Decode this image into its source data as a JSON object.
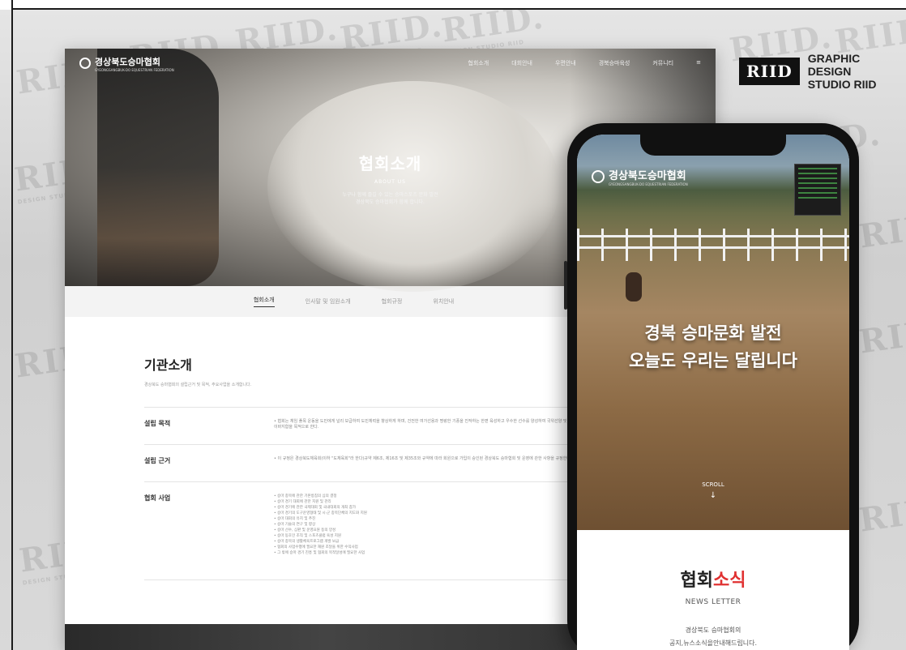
{
  "brand": {
    "logo": "RIID",
    "line1": "GRAPHIC DESIGN",
    "line2": "STUDIO RIID"
  },
  "watermark": {
    "text": "RIID.",
    "sub": "DESIGN STUDIO RIID"
  },
  "desktop": {
    "logo": "경상북도승마협회",
    "logo_sub": "GYEONGSANGBUK-DO EQUESTRIAN FEDERATION",
    "menu": [
      "협회소개",
      "대회안내",
      "우편안내",
      "경북승마육성",
      "커뮤니티",
      "≡"
    ],
    "hero_title": "협회소개",
    "hero_sub": "ABOUT US",
    "hero_desc": "누구나 함께 즐길 수 있는 승마스포츠 문화 발전\n경상북도 승마협회가 함께 합니다.",
    "tabs": [
      "협회소개",
      "인사말 및 임원소개",
      "협회규정",
      "위치안내"
    ],
    "section_title": "기관소개",
    "section_lead": "경상북도 승마협회의 설립근거 및 목적, 주요사업을 소개합니다.",
    "rows": [
      {
        "label": "설립 목적",
        "text": "• 협회는 체임 풀목 운동을 도민에게 널리 보급하여 도민체력을 향상하게 하며, 건전한 여가선용과 명랑한 기풍을 진작하는 한편 육성하고 우수한 선수를 양성하여 국위선양 및 지역체육 발전에 이바지함을 목적으로 한다."
      },
      {
        "label": "설립 근거",
        "text": "• 이 규정은 경상북도체육회(이하 \"도체육회\"라 한다)규약 제6조, 제16조 및 제35조와 규약에 따라 회원으로 가입이 승인된 경상북도 승마협회 및 운영에 관한 사항을 규정한다."
      },
      {
        "label": "협회 사업",
        "list": [
          "• 승마 종목에 관한 기본방침의 심의 결정",
          "• 승마 경기 대회에 관한 지원 및 관리",
          "• 승마 경기에 관한 국제대회 및 국내대회의 개최 참가",
          "• 승마 경기의 도구운영형태 및 시·군 종목단체의 지도와 지원",
          "• 승마 대회의 유치 및 추진",
          "• 승마 기술의 연구 및 향상",
          "• 승마 선수, 심판 및 운영요원 등의 양성",
          "• 승마 동호인 조직 및 스포츠클럽 육성 지원",
          "• 승마 종목의 생활체육프로그램 개발 보급",
          "• 협회의 사업수행에 필요한 재원 조달을 위한 수익사업",
          "• 그 밖에 승마 경기 진흥 및 협회의 목적달성에 필요한 사업"
        ]
      }
    ]
  },
  "phone": {
    "logo": "경상북도승마협회",
    "logo_sub": "GYEONGSANGBUK-DO EQUESTRIAN FEDERATION",
    "headline1": "경북 승마문화 발전",
    "headline2": "오늘도 우리는 달립니다",
    "scroll": "SCROLL",
    "news_title_black": "협회",
    "news_title_red": "소식",
    "news_en": "NEWS LETTER",
    "news_desc1": "경상북도 승마협회의",
    "news_desc2": "공지,뉴스소식을안내해드립니다."
  },
  "colors": {
    "accent_red": "#e03131",
    "brand_black": "#111111"
  }
}
